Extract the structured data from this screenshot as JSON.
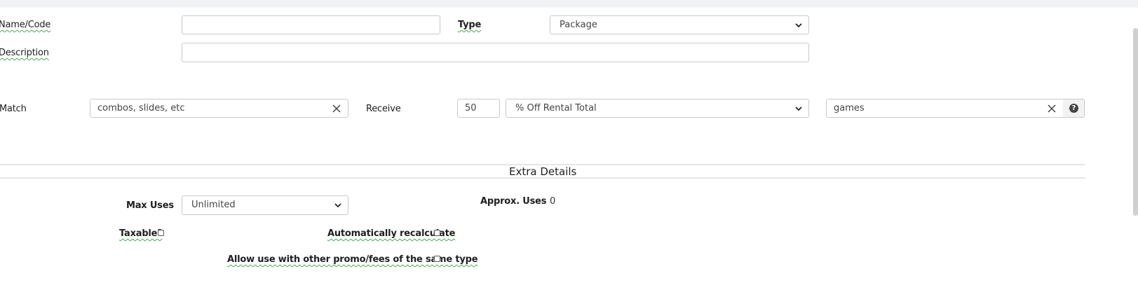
{
  "form": {
    "name_code": {
      "label": "Name/Code",
      "value": ""
    },
    "type": {
      "label": "Type",
      "value": "Package"
    },
    "description": {
      "label": "Description",
      "value": ""
    },
    "match": {
      "label": "Match",
      "value": "combos, slides, etc"
    },
    "receive": {
      "label": "Receive",
      "amount": "50",
      "mode": "% Off Rental Total",
      "target": "games"
    }
  },
  "extra": {
    "title": "Extra Details",
    "max_uses": {
      "label": "Max Uses",
      "value": "Unlimited"
    },
    "approx_uses": {
      "label": "Approx. Uses",
      "value": "0"
    },
    "taxable": {
      "label": "Taxable?",
      "checked": false
    },
    "auto_recalc": {
      "label": "Automatically recalculate",
      "checked": false
    },
    "allow_other": {
      "label": "Allow use with other promo/fees of the same type",
      "checked": false
    }
  },
  "icons": [
    "chevron-down-icon",
    "clear-icon",
    "help-icon"
  ]
}
